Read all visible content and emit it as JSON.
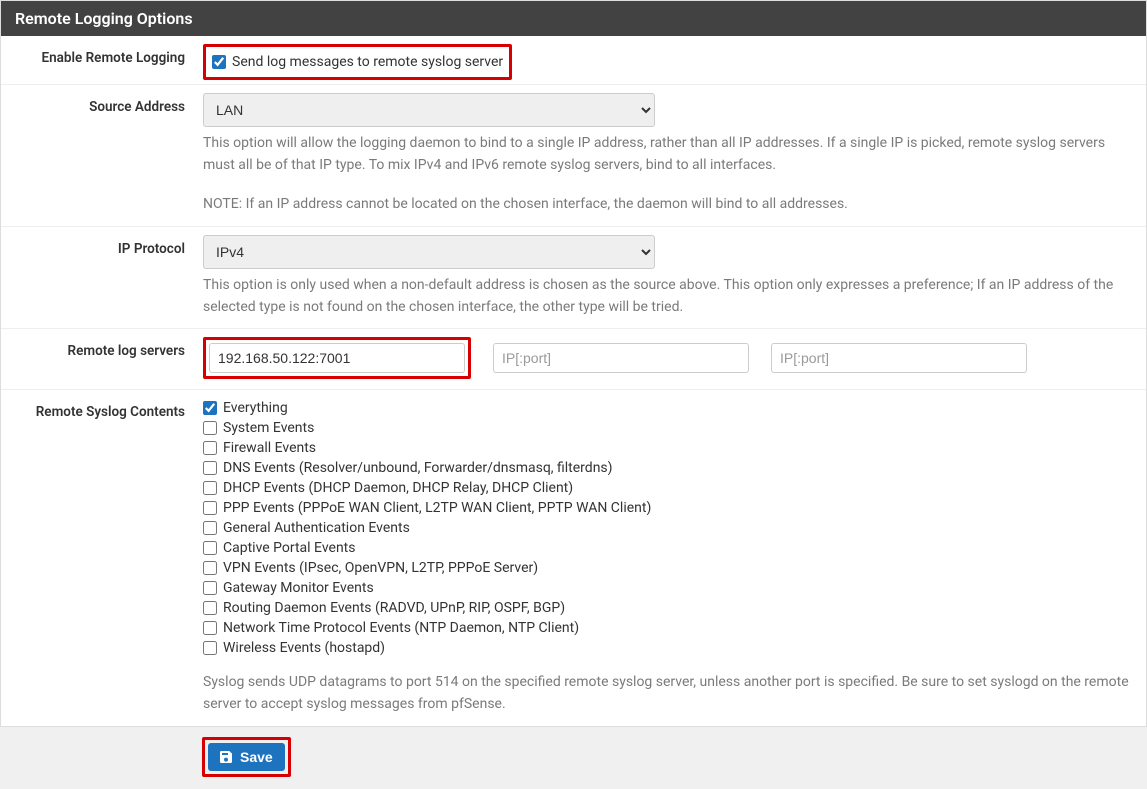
{
  "panel": {
    "title": "Remote Logging Options"
  },
  "enable": {
    "label": "Enable Remote Logging",
    "checkbox_label": "Send log messages to remote syslog server",
    "checked": true
  },
  "source": {
    "label": "Source Address",
    "value": "LAN",
    "help1": "This option will allow the logging daemon to bind to a single IP address, rather than all IP addresses. If a single IP is picked, remote syslog servers must all be of that IP type. To mix IPv4 and IPv6 remote syslog servers, bind to all interfaces.",
    "help2": "NOTE: If an IP address cannot be located on the chosen interface, the daemon will bind to all addresses."
  },
  "protocol": {
    "label": "IP Protocol",
    "value": "IPv4",
    "help": "This option is only used when a non-default address is chosen as the source above. This option only expresses a preference; If an IP address of the selected type is not found on the chosen interface, the other type will be tried."
  },
  "servers": {
    "label": "Remote log servers",
    "value1": "192.168.50.122:7001",
    "placeholder": "IP[:port]"
  },
  "contents": {
    "label": "Remote Syslog Contents",
    "items": [
      {
        "label": "Everything",
        "checked": true
      },
      {
        "label": "System Events",
        "checked": false
      },
      {
        "label": "Firewall Events",
        "checked": false
      },
      {
        "label": "DNS Events (Resolver/unbound, Forwarder/dnsmasq, filterdns)",
        "checked": false
      },
      {
        "label": "DHCP Events (DHCP Daemon, DHCP Relay, DHCP Client)",
        "checked": false
      },
      {
        "label": "PPP Events (PPPoE WAN Client, L2TP WAN Client, PPTP WAN Client)",
        "checked": false
      },
      {
        "label": "General Authentication Events",
        "checked": false
      },
      {
        "label": "Captive Portal Events",
        "checked": false
      },
      {
        "label": "VPN Events (IPsec, OpenVPN, L2TP, PPPoE Server)",
        "checked": false
      },
      {
        "label": "Gateway Monitor Events",
        "checked": false
      },
      {
        "label": "Routing Daemon Events (RADVD, UPnP, RIP, OSPF, BGP)",
        "checked": false
      },
      {
        "label": "Network Time Protocol Events (NTP Daemon, NTP Client)",
        "checked": false
      },
      {
        "label": "Wireless Events (hostapd)",
        "checked": false
      }
    ],
    "help": "Syslog sends UDP datagrams to port 514 on the specified remote syslog server, unless another port is specified. Be sure to set syslogd on the remote server to accept syslog messages from pfSense."
  },
  "save": {
    "label": "Save"
  }
}
